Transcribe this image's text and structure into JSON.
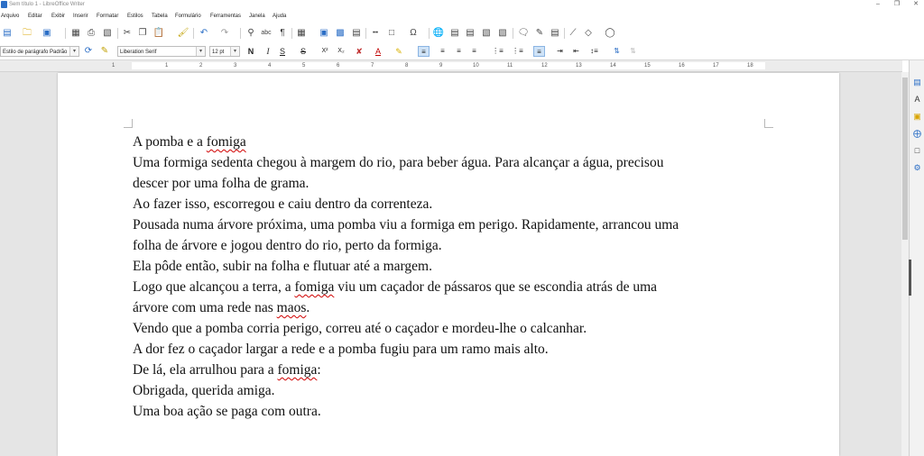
{
  "window": {
    "title": "Sem título 1 - LibreOffice Writer"
  },
  "menu": [
    "Arquivo",
    "Editar",
    "Exibir",
    "Inserir",
    "Formatar",
    "Estilos",
    "Tabela",
    "Formulário",
    "Ferramentas",
    "Janela",
    "Ajuda"
  ],
  "formatting": {
    "paragraph_style": "Estilo de parágrafo Padrão",
    "font_name": "Liberation Serif",
    "font_size": "12 pt"
  },
  "ruler": {
    "numbers": [
      "1",
      "1",
      "2",
      "3",
      "4",
      "5",
      "6",
      "7",
      "8",
      "9",
      "10",
      "11",
      "12",
      "13",
      "14",
      "15",
      "16",
      "17",
      "18"
    ]
  },
  "document": {
    "lines": [
      {
        "parts": [
          {
            "t": "A pomba e a ",
            "e": false
          },
          {
            "t": "fomiga",
            "e": true
          }
        ]
      },
      {
        "parts": [
          {
            "t": "Uma formiga sedenta chegou à margem do rio, para beber água. Para alcançar a água, precisou",
            "e": false
          }
        ]
      },
      {
        "parts": [
          {
            "t": "descer por uma folha de grama.",
            "e": false
          }
        ]
      },
      {
        "parts": [
          {
            "t": "Ao fazer isso, escorregou e caiu dentro da correnteza.",
            "e": false
          }
        ]
      },
      {
        "parts": [
          {
            "t": "Pousada numa árvore próxima, uma pomba viu a formiga em perigo. Rapidamente, arrancou uma",
            "e": false
          }
        ]
      },
      {
        "parts": [
          {
            "t": "folha de árvore e jogou dentro do rio, perto da formiga.",
            "e": false
          }
        ]
      },
      {
        "parts": [
          {
            "t": "Ela pôde então, subir na folha e flutuar até a margem.",
            "e": false
          }
        ]
      },
      {
        "parts": [
          {
            "t": "Logo que alcançou a terra, a ",
            "e": false
          },
          {
            "t": "fomiga",
            "e": true
          },
          {
            "t": " viu um caçador de pássaros que se escondia atrás de uma",
            "e": false
          }
        ]
      },
      {
        "parts": [
          {
            "t": "árvore com uma rede nas ",
            "e": false
          },
          {
            "t": "maos",
            "e": true
          },
          {
            "t": ".",
            "e": false
          }
        ]
      },
      {
        "parts": [
          {
            "t": "Vendo que a pomba corria perigo, correu até o caçador e mordeu-lhe o calcanhar.",
            "e": false
          }
        ]
      },
      {
        "parts": [
          {
            "t": "A dor fez o caçador largar a rede e a pomba fugiu para um ramo mais alto.",
            "e": false
          }
        ]
      },
      {
        "parts": [
          {
            "t": "De lá, ela arrulhou para a ",
            "e": false
          },
          {
            "t": "fomiga",
            "e": true
          },
          {
            "t": ":",
            "e": false
          }
        ]
      },
      {
        "parts": [
          {
            "t": "Obrigada, querida amiga.",
            "e": false
          }
        ]
      },
      {
        "parts": [
          {
            "t": "Uma boa ação se paga com outra.",
            "e": false
          }
        ]
      }
    ]
  },
  "colors": {
    "accent": "#2b6ec6",
    "spell_error": "#d00000",
    "workspace": "#e5e5e5"
  }
}
